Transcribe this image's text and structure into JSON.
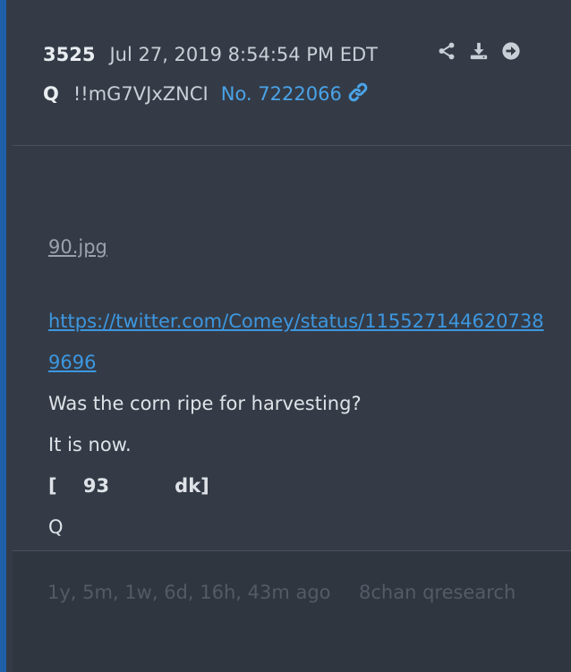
{
  "post": {
    "number": "3525",
    "datetime": "Jul 27, 2019 8:54:54 PM EDT",
    "author": "Q",
    "tripcode": "!!mG7VJxZNCI",
    "post_no": "No. 7222066"
  },
  "icons": [
    "share-icon",
    "download-icon",
    "goto-icon",
    "link-icon"
  ],
  "body": {
    "image_link": "90.jpg",
    "tweet_url": "https://twitter.com/Comey/status/1155271446207389696",
    "line1": "Was the corn ripe for harvesting?",
    "line2": "It is now.",
    "bracket": "[    93          dk]",
    "signature": "Q"
  },
  "footer": {
    "age": "1y, 5m, 1w, 6d, 16h, 43m ago",
    "source": "8chan qresearch"
  },
  "colors": {
    "accent_border": "#1f5fa8",
    "link": "#3d97e0",
    "post_no": "#4aa3e8"
  }
}
